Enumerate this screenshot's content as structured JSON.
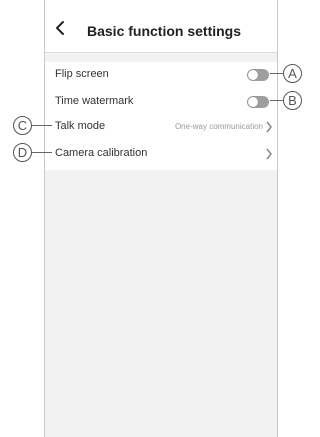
{
  "header": {
    "title": "Basic function settings"
  },
  "settings": [
    {
      "label": "Flip screen",
      "type": "toggle",
      "on": false
    },
    {
      "label": "Time watermark",
      "type": "toggle",
      "on": false
    },
    {
      "label": "Talk mode",
      "type": "select",
      "value": "One-way communication"
    },
    {
      "label": "Camera calibration",
      "type": "link"
    }
  ],
  "callouts": {
    "a": "A",
    "b": "B",
    "c": "C",
    "d": "D"
  },
  "colors": {
    "toggle_off": "#9e9e9e",
    "background": "#f2f2f2"
  }
}
